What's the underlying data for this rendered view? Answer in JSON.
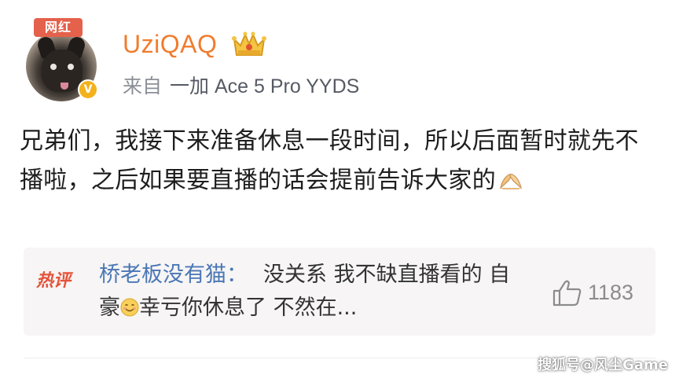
{
  "post": {
    "badge": "网红",
    "username": "UziQAQ",
    "source_prefix": "来自",
    "source_device": "一加 Ace 5 Pro YYDS",
    "text": "兄弟们，我接下来准备休息一段时间，所以后面暂时就先不播啦，之后如果要直播的话会提前告诉大家的",
    "icons": [
      "crown-icon",
      "verified-icon",
      "clap-icon"
    ]
  },
  "hot_comment": {
    "label": "热评",
    "user": "桥老板没有猫：",
    "text_a": "没关系 我不缺直播看的 自豪",
    "text_b": "幸亏你休息了 不然在...",
    "likes": "1183",
    "icons": [
      "smile-icon",
      "like-icon"
    ]
  },
  "watermark": "搜狐号@风尘Game",
  "colors": {
    "username": "#f07c2e",
    "badge": "#e4614b",
    "comment_user": "#4a77b5",
    "hot_label": "#e5533a",
    "comment_bg": "#f7f5f5"
  }
}
